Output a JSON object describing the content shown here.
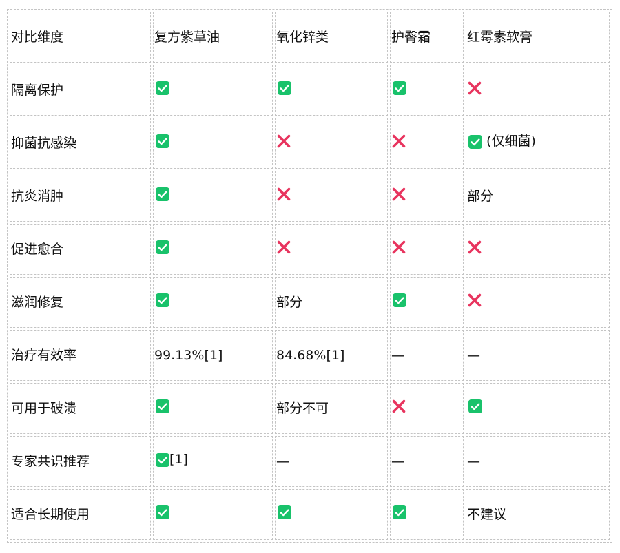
{
  "colors": {
    "check_bg": "#19c26b",
    "cross": "#e8345e",
    "border": "#c4c4c4"
  },
  "table": {
    "headers": [
      "对比维度",
      "复方紫草油",
      "氧化锌类",
      "护臀霜",
      "红霉素软膏"
    ],
    "rows": [
      {
        "dimension": "隔离保护",
        "cells": [
          {
            "icon": "check"
          },
          {
            "icon": "check"
          },
          {
            "icon": "check"
          },
          {
            "icon": "cross"
          }
        ]
      },
      {
        "dimension": "抑菌抗感染",
        "cells": [
          {
            "icon": "check"
          },
          {
            "icon": "cross"
          },
          {
            "icon": "cross"
          },
          {
            "icon": "check",
            "text": " (仅细菌)"
          }
        ]
      },
      {
        "dimension": "抗炎消肿",
        "cells": [
          {
            "icon": "check"
          },
          {
            "icon": "cross"
          },
          {
            "icon": "cross"
          },
          {
            "text": "部分"
          }
        ]
      },
      {
        "dimension": "促进愈合",
        "cells": [
          {
            "icon": "check"
          },
          {
            "icon": "cross"
          },
          {
            "icon": "cross"
          },
          {
            "icon": "cross"
          }
        ]
      },
      {
        "dimension": "滋润修复",
        "cells": [
          {
            "icon": "check"
          },
          {
            "text": "部分"
          },
          {
            "icon": "check"
          },
          {
            "icon": "cross"
          }
        ]
      },
      {
        "dimension": "治疗有效率",
        "cells": [
          {
            "text": "99.13%[1]"
          },
          {
            "text": "84.68%[1]"
          },
          {
            "text": "—"
          },
          {
            "text": "—"
          }
        ]
      },
      {
        "dimension": "可用于破溃",
        "cells": [
          {
            "icon": "check"
          },
          {
            "text": "部分不可"
          },
          {
            "icon": "cross"
          },
          {
            "icon": "check"
          }
        ]
      },
      {
        "dimension": "专家共识推荐",
        "cells": [
          {
            "icon": "check",
            "text": "[1]"
          },
          {
            "text": "—"
          },
          {
            "text": "—"
          },
          {
            "text": "—"
          }
        ]
      },
      {
        "dimension": "适合长期使用",
        "cells": [
          {
            "icon": "check"
          },
          {
            "icon": "check"
          },
          {
            "icon": "check"
          },
          {
            "text": "不建议"
          }
        ]
      }
    ]
  }
}
